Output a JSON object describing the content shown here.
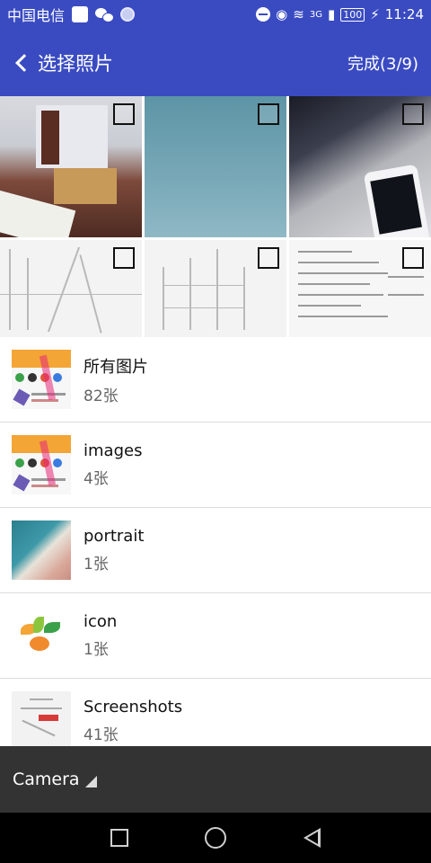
{
  "status_bar": {
    "carrier": "中国电信",
    "network": "3G",
    "battery": "100",
    "time": "11:24"
  },
  "app_bar": {
    "title": "选择照片",
    "done_label": "完成(3/9)"
  },
  "photos": [
    {
      "name": "office-photo",
      "checked": false
    },
    {
      "name": "blue-surface-photo",
      "checked": false
    },
    {
      "name": "phone-on-desk-photo",
      "checked": false
    },
    {
      "name": "street-sketch-photo",
      "checked": false
    },
    {
      "name": "building-sketch-photo",
      "checked": false
    },
    {
      "name": "document-photo",
      "checked": false
    }
  ],
  "albums": [
    {
      "name": "所有图片",
      "count": "82张"
    },
    {
      "name": "images",
      "count": "4张"
    },
    {
      "name": "portrait",
      "count": "1张"
    },
    {
      "name": "icon",
      "count": "1张"
    },
    {
      "name": "Screenshots",
      "count": "41张"
    }
  ],
  "bottom_bar": {
    "current_bucket": "Camera"
  },
  "colors": {
    "accent": "#3a4bc2",
    "bottom_bar": "#333333"
  }
}
